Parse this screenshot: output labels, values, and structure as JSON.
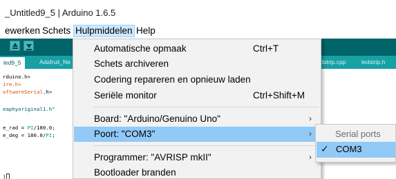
{
  "window": {
    "title": "_Untitled9_5 | Arduino 1.6.5"
  },
  "menubar": {
    "items": [
      {
        "label": "ewerken"
      },
      {
        "label": "Schets"
      },
      {
        "label": "Hulpmiddelen"
      },
      {
        "label": "Help"
      }
    ]
  },
  "tabs": [
    {
      "label": "led9_5"
    },
    {
      "label": "Adafruit_Ne"
    },
    {
      "label": "ledstrip.cpp"
    },
    {
      "label": "ledstrip.h"
    }
  ],
  "code": {
    "line1": "rduino.h>",
    "line2": "ire.h>",
    "line3_kw": "oftwareSerial",
    "line3_end": ".h>",
    "line4": "eaphyoriginal1.h\"",
    "line5_a": "e_rad = ",
    "line5_b": "PI",
    "line5_c": "/180.0;",
    "line6_a": "e_deg = 180.0/",
    "line6_b": "PI",
    "line6_c": ";",
    "line7": ")"
  },
  "tools_menu": {
    "items": [
      {
        "label": "Automatische opmaak",
        "shortcut": "Ctrl+T"
      },
      {
        "label": "Schets archiveren"
      },
      {
        "label": "Codering repareren en opnieuw laden"
      },
      {
        "label": "Seriële monitor",
        "shortcut": "Ctrl+Shift+M"
      },
      {
        "label": "Board: \"Arduino/Genuino Uno\""
      },
      {
        "label": "Poort: \"COM3\""
      },
      {
        "label": "Programmer: \"AVRISP mkII\""
      },
      {
        "label": "Bootloader branden"
      }
    ]
  },
  "port_submenu": {
    "header": "Serial ports",
    "options": [
      {
        "label": "COM3",
        "checked": true
      }
    ]
  },
  "colors": {
    "toolbar": "#006468",
    "tabstrip": "#17a1a5",
    "menu_highlight": "#91c9f7"
  }
}
